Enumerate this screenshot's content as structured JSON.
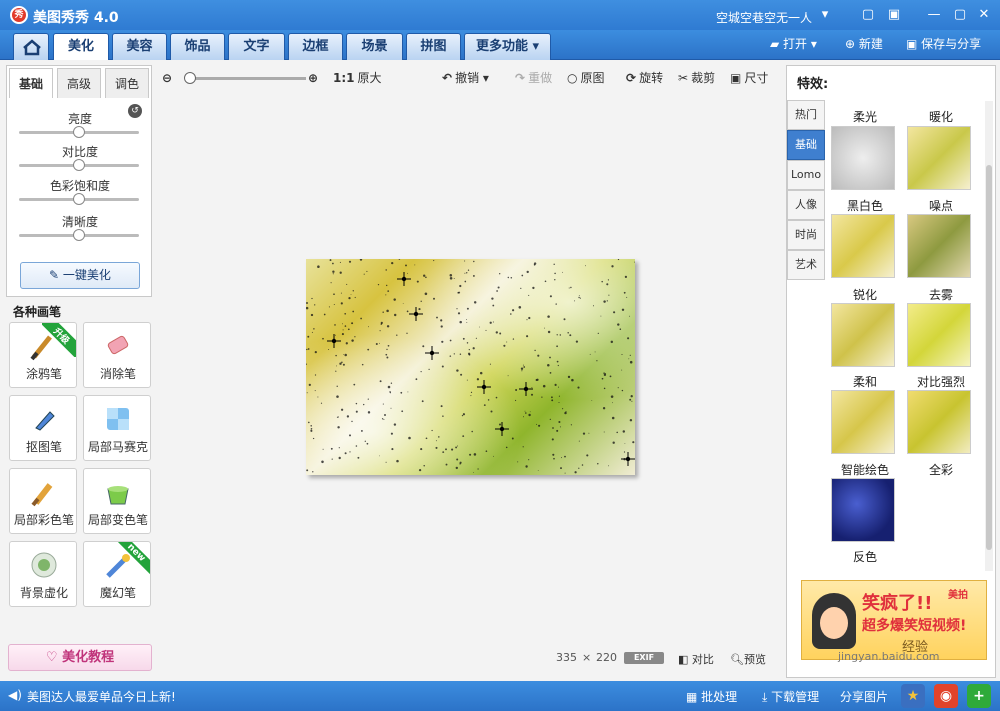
{
  "app": {
    "logo": "秀",
    "title": "美图秀秀 4.0",
    "user": "空城空巷空无一人"
  },
  "window_icons": {
    "dropdown": "▾",
    "chat": "▢",
    "settings": "▣",
    "minimize": "—",
    "maximize": "▢",
    "close": "✕"
  },
  "top_tabs": [
    "美化",
    "美容",
    "饰品",
    "文字",
    "边框",
    "场景",
    "拼图",
    "更多功能"
  ],
  "top_actions": {
    "open": "打开",
    "new": "新建",
    "save_share": "保存与分享"
  },
  "left": {
    "subtabs": [
      "基础",
      "高级",
      "调色"
    ],
    "sliders": [
      {
        "label": "亮度",
        "value": 0.5
      },
      {
        "label": "对比度",
        "value": 0.5
      },
      {
        "label": "色彩饱和度",
        "value": 0.5
      },
      {
        "label": "清晰度",
        "value": 0.5
      }
    ],
    "one_key": "一键美化",
    "brushes_title": "各种画笔",
    "brushes": [
      {
        "label": "涂鸦笔",
        "badge": "升级"
      },
      {
        "label": "消除笔",
        "badge": ""
      },
      {
        "label": "抠图笔",
        "badge": ""
      },
      {
        "label": "局部马赛克",
        "badge": ""
      },
      {
        "label": "局部彩色笔",
        "badge": ""
      },
      {
        "label": "局部变色笔",
        "badge": ""
      },
      {
        "label": "背景虚化",
        "badge": ""
      },
      {
        "label": "魔幻笔",
        "badge": "new"
      }
    ],
    "tutorial": "美化教程"
  },
  "toolbar": {
    "zoom_value": 0.0,
    "ratio": "1:1",
    "original_size": "原大",
    "undo": "撤销",
    "redo": "重做",
    "original": "原图",
    "rotate": "旋转",
    "crop": "裁剪",
    "size": "尺寸"
  },
  "status": {
    "width": "335",
    "x": "×",
    "height": "220",
    "exif": "EXIF",
    "compare": "对比",
    "preview": "预览"
  },
  "right": {
    "title": "特效:",
    "cat_tabs": [
      "热门",
      "基础",
      "Lomo",
      "人像",
      "时尚",
      "艺术"
    ],
    "effects": [
      "柔光",
      "暖化",
      "黑白色",
      "噪点",
      "锐化",
      "去雾",
      "柔和",
      "对比强烈",
      "智能绘色",
      "全彩",
      "反色"
    ],
    "ad": {
      "line1": "笑疯了!!",
      "line2": "超多爆笑短视频!",
      "line3": "经验",
      "brand": "美拍"
    }
  },
  "watermark": "jingyan.baidu.com",
  "bottom": {
    "news": "美图达人最爱单品今日上新!",
    "batch": "批处理",
    "download": "下载管理",
    "share": "分享图片"
  },
  "colors": {
    "accent": "#2f7bd2",
    "active_cat": "#3f7fcf",
    "ribbon": "#23a33b"
  }
}
